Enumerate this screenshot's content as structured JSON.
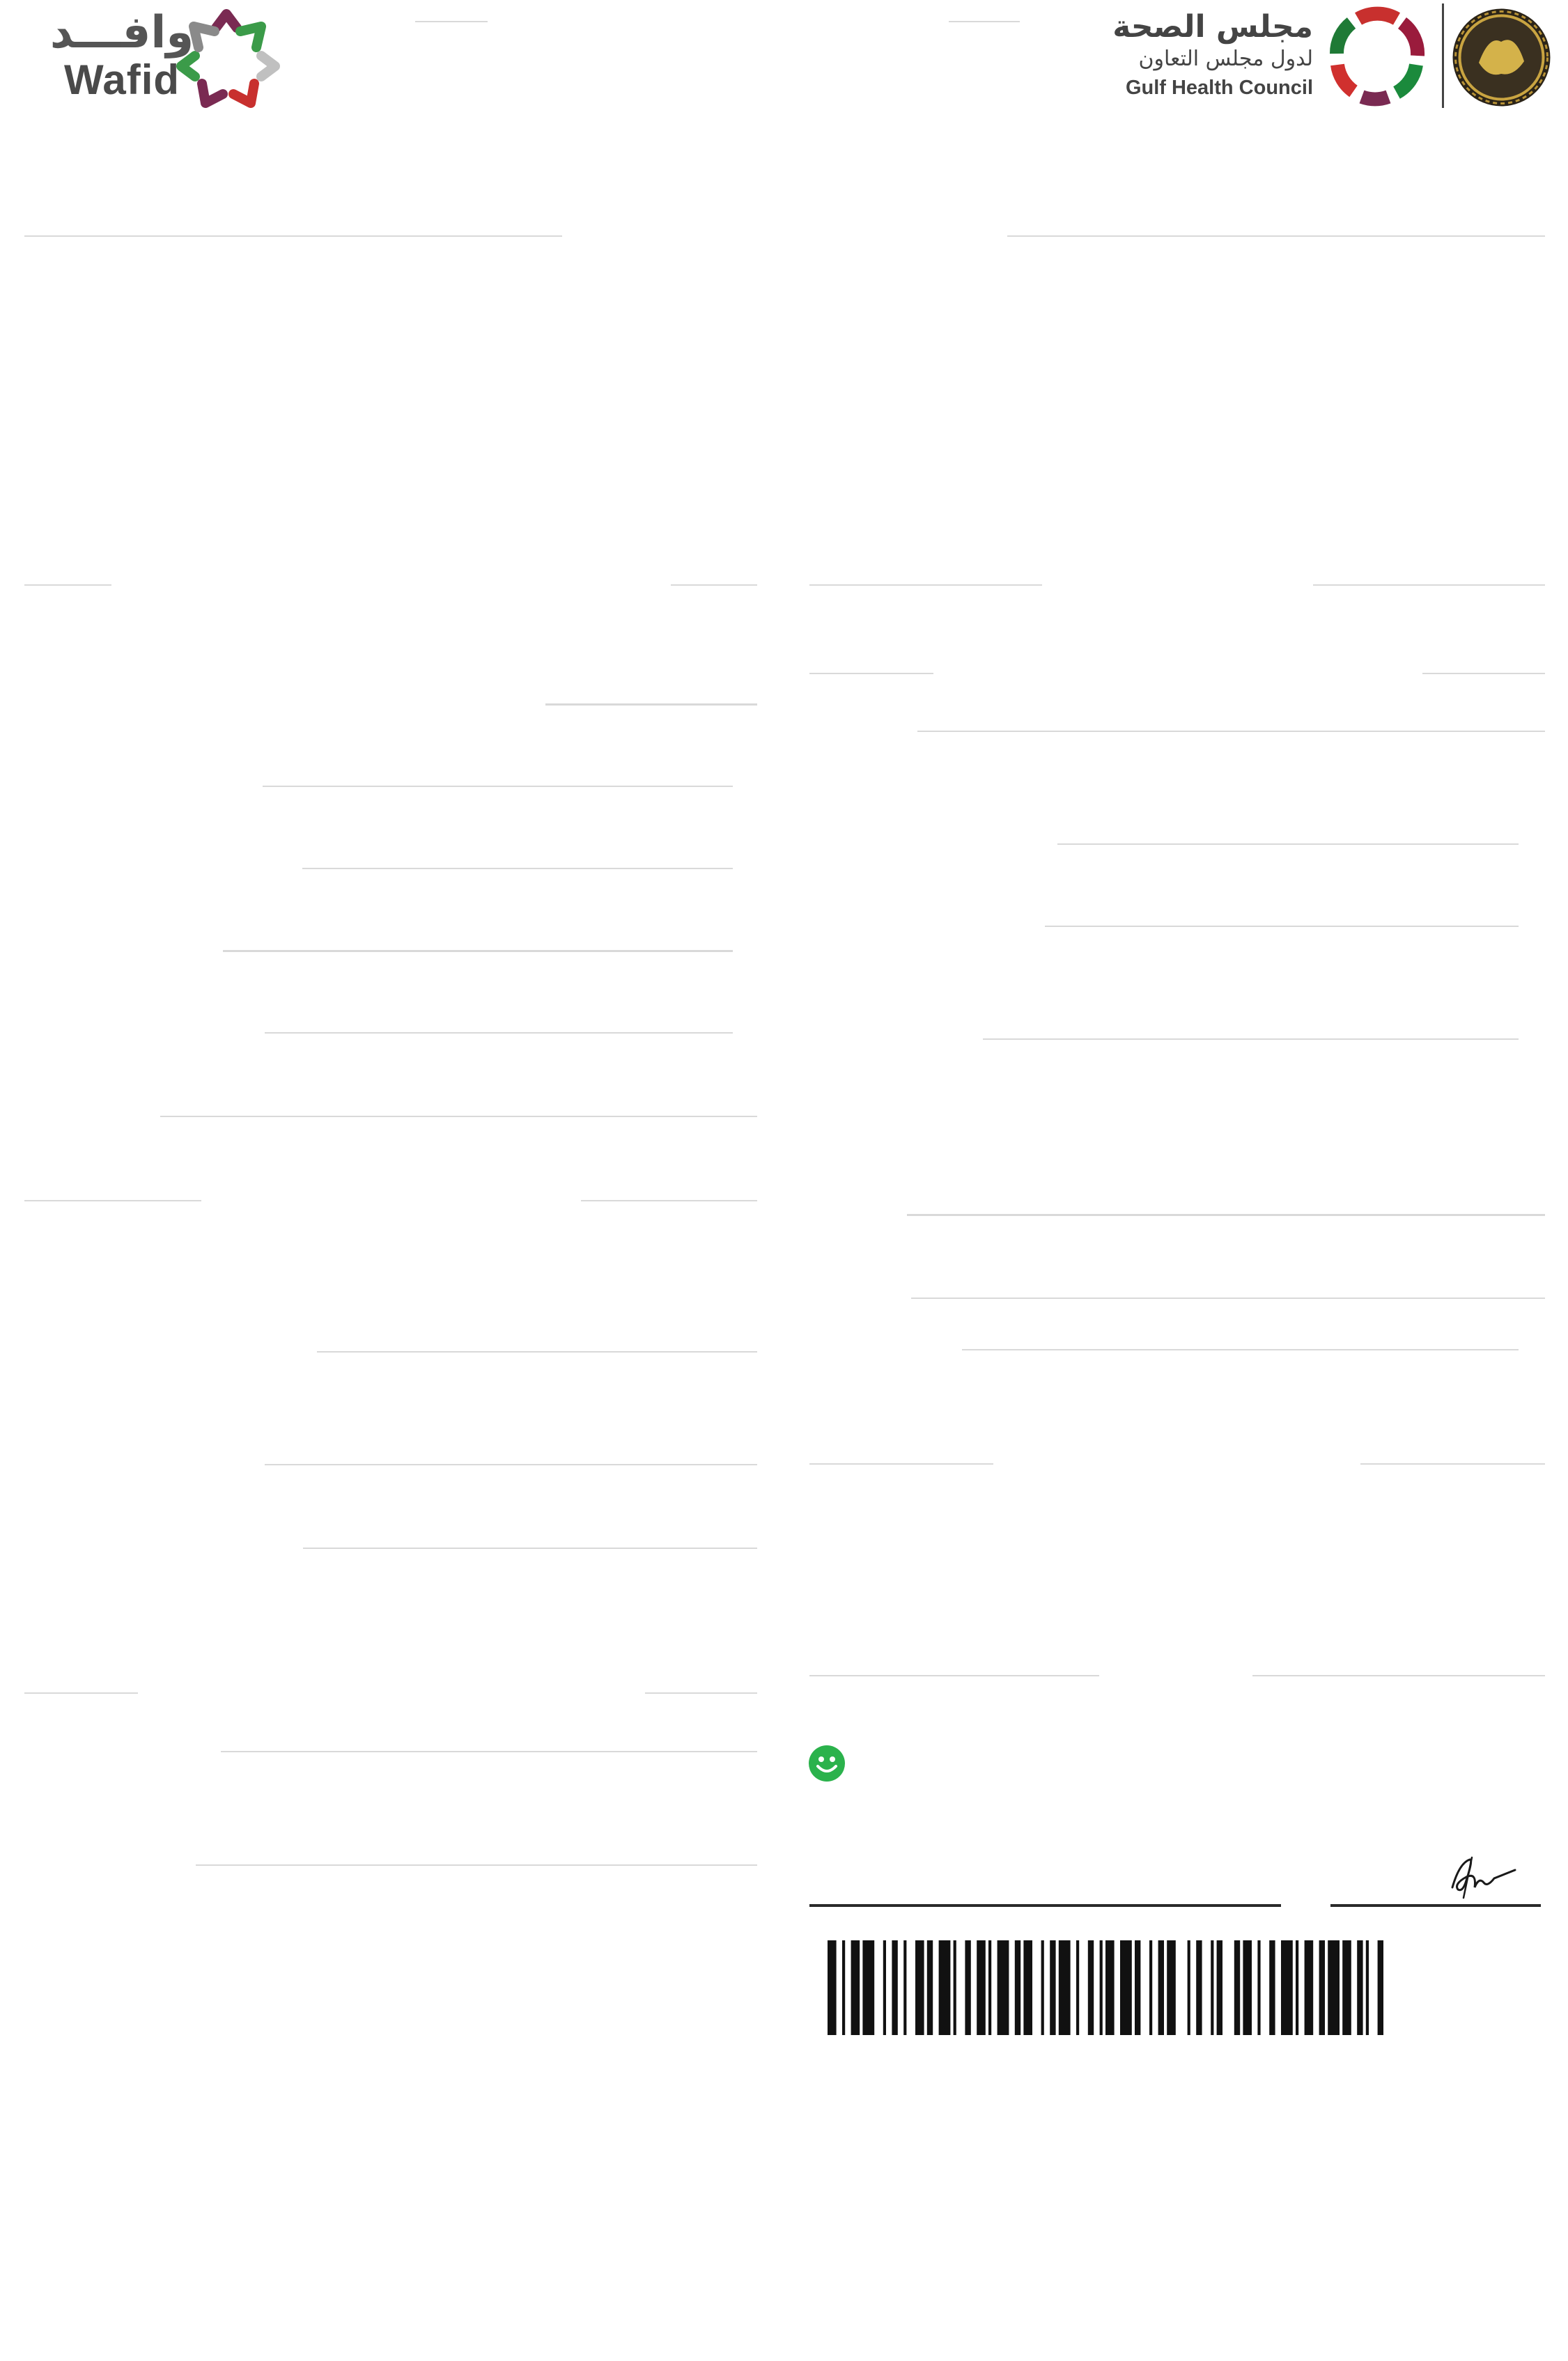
{
  "header": {
    "wafid_logo": {
      "arabic": "وافـــد",
      "english": "Wafid"
    },
    "ghc_logo": {
      "arabic_line1": "مجلس الصحة",
      "arabic_line2": "لدول مجلس التعاون",
      "english": "Gulf Health Council"
    }
  },
  "status": {
    "icon": "smiley-icon",
    "color": "#2bb24c"
  },
  "signature": {
    "icon": "signature-icon"
  },
  "barcode": {
    "icon": "barcode-icon"
  }
}
